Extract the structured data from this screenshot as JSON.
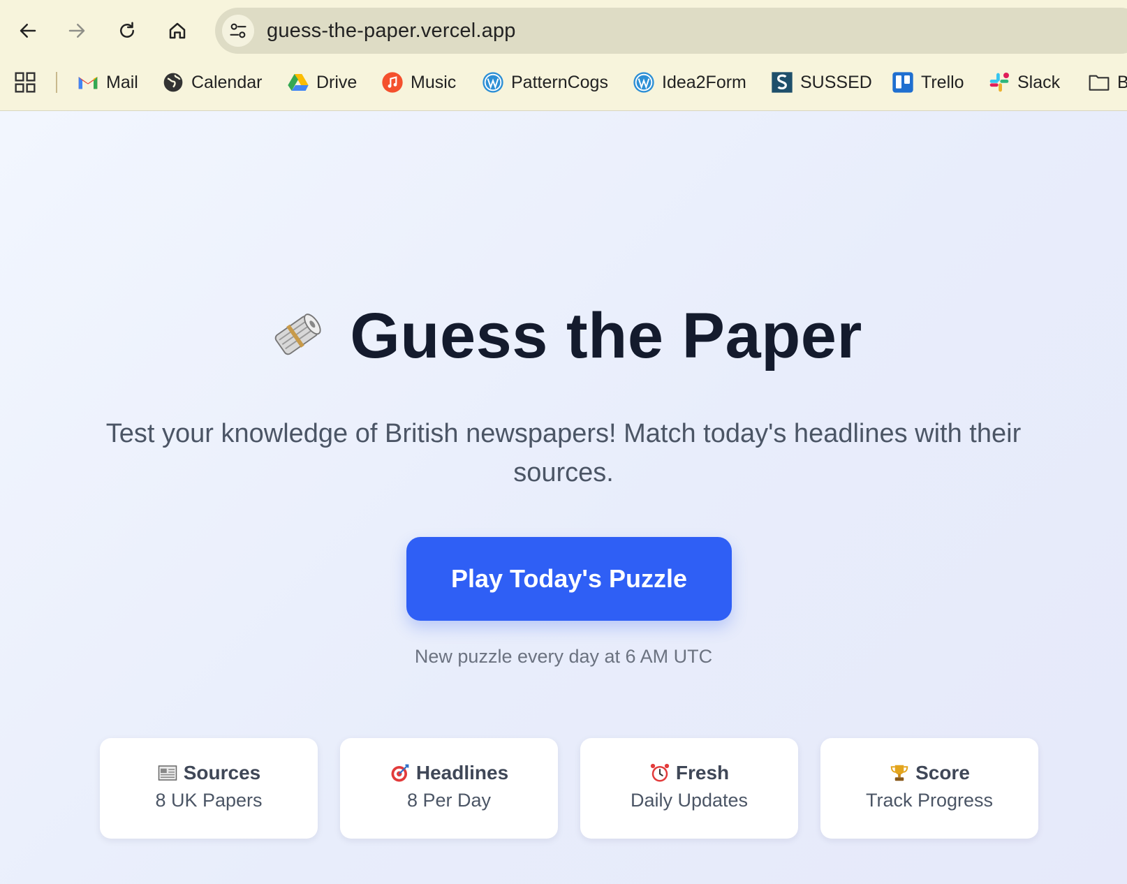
{
  "browser": {
    "url": "guess-the-paper.vercel.app",
    "bookmarks": [
      {
        "label": "Mail",
        "icon": "gmail-icon"
      },
      {
        "label": "Calendar",
        "icon": "globe-icon"
      },
      {
        "label": "Drive",
        "icon": "google-drive-icon"
      },
      {
        "label": "Music",
        "icon": "music-icon"
      },
      {
        "label": "PatternCogs",
        "icon": "wordpress-icon"
      },
      {
        "label": "Idea2Form",
        "icon": "wordpress-icon"
      },
      {
        "label": "SUSSED",
        "icon": "sussed-icon"
      },
      {
        "label": "Trello",
        "icon": "trello-icon"
      },
      {
        "label": "Slack",
        "icon": "slack-icon"
      },
      {
        "label": "B",
        "icon": "folder-icon"
      }
    ]
  },
  "hero": {
    "title": "Guess the Paper",
    "title_icon": "rolled-newspaper-icon",
    "subtitle": "Test your knowledge of British newspapers! Match today's headlines with their sources.",
    "cta_label": "Play Today's Puzzle",
    "cta_note": "New puzzle every day at 6 AM UTC"
  },
  "features": [
    {
      "title": "Sources",
      "value": "8 UK Papers",
      "icon": "newspaper-icon"
    },
    {
      "title": "Headlines",
      "value": "8 Per Day",
      "icon": "target-icon"
    },
    {
      "title": "Fresh",
      "value": "Daily Updates",
      "icon": "alarm-clock-icon"
    },
    {
      "title": "Score",
      "value": "Track Progress",
      "icon": "trophy-icon"
    }
  ],
  "colors": {
    "accent": "#2f5ff5",
    "chrome_bg": "#f7f4dc",
    "title_text": "#141b2d"
  }
}
